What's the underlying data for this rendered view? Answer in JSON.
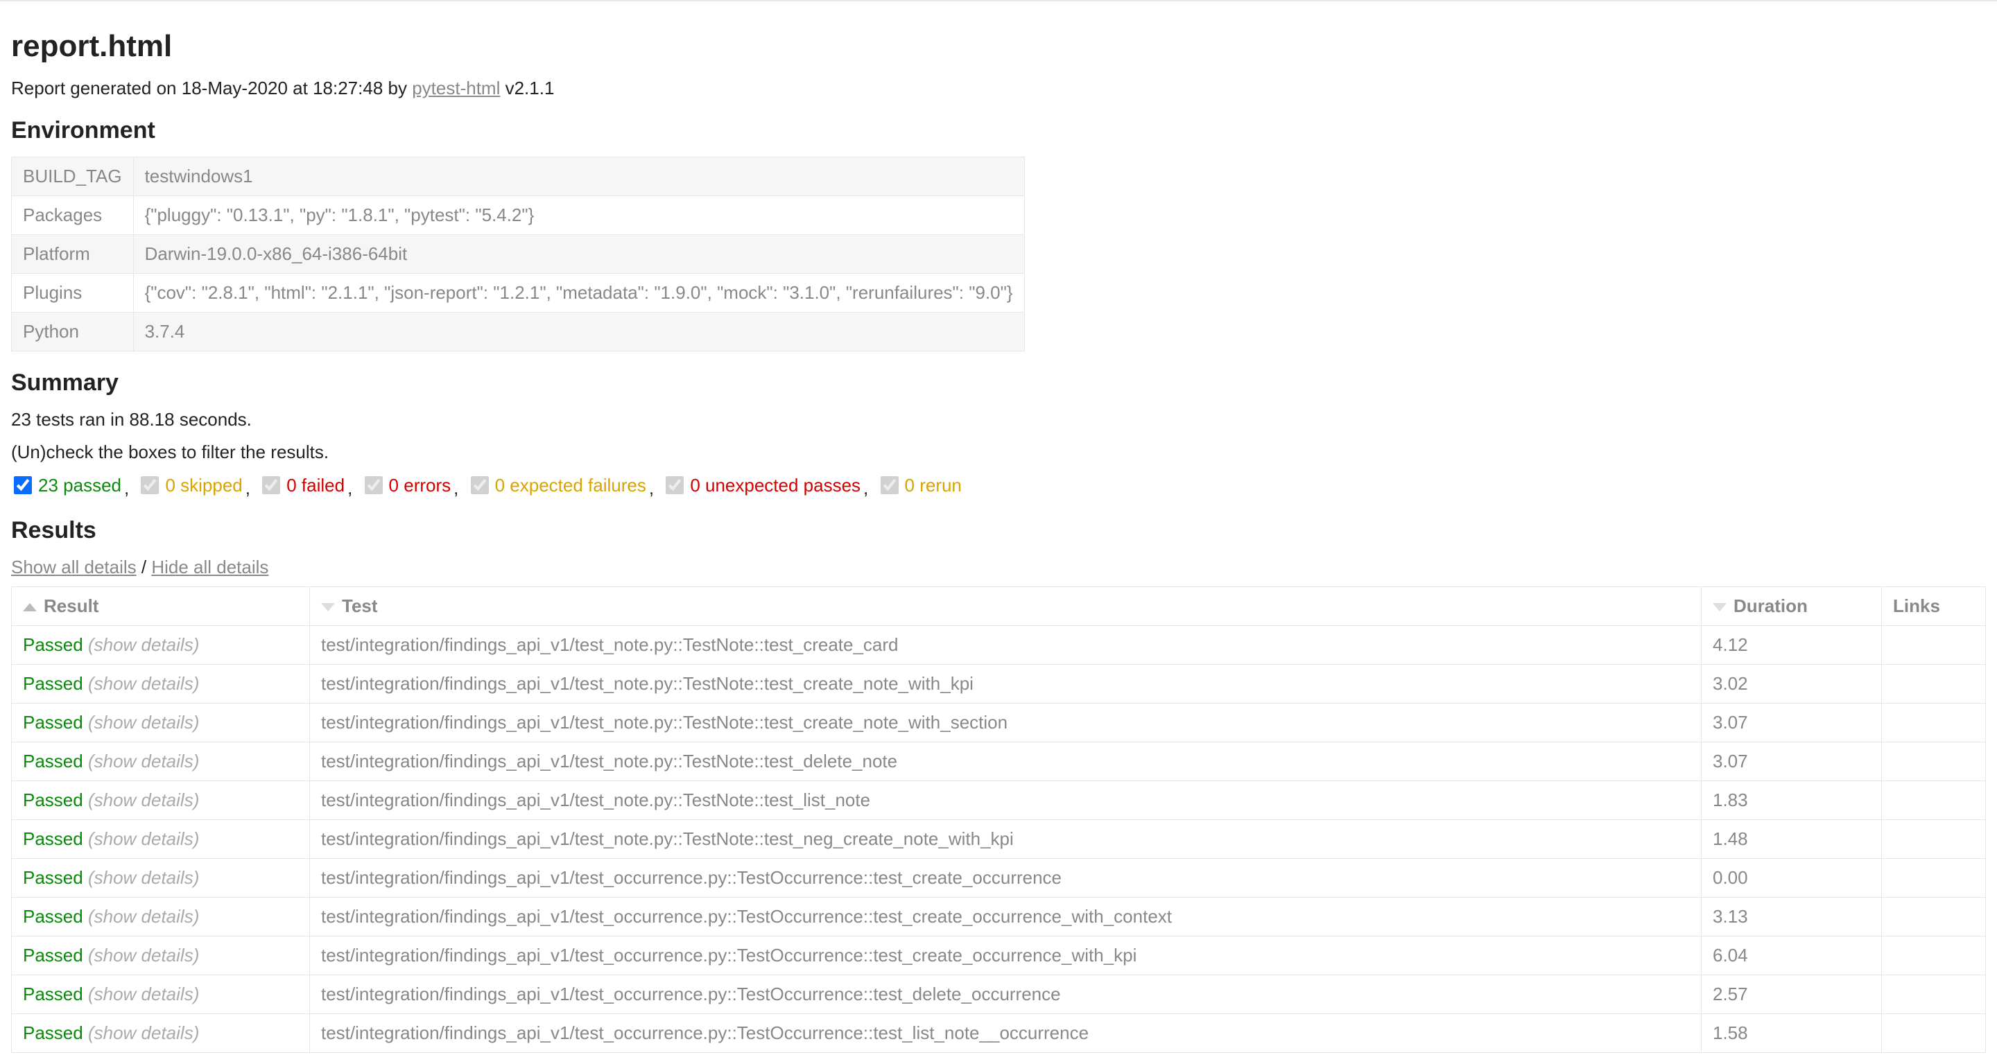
{
  "title": "report.html",
  "report_meta": {
    "prefix": "Report generated on ",
    "date": "18-May-2020",
    "at": " at ",
    "time": "18:27:48",
    "by": " by ",
    "tool_link": "pytest-html",
    "version": " v2.1.1"
  },
  "environment": {
    "heading": "Environment",
    "rows": [
      {
        "key": "BUILD_TAG",
        "value": "testwindows1"
      },
      {
        "key": "Packages",
        "value": "{\"pluggy\": \"0.13.1\", \"py\": \"1.8.1\", \"pytest\": \"5.4.2\"}"
      },
      {
        "key": "Platform",
        "value": "Darwin-19.0.0-x86_64-i386-64bit"
      },
      {
        "key": "Plugins",
        "value": "{\"cov\": \"2.8.1\", \"html\": \"2.1.1\", \"json-report\": \"1.2.1\", \"metadata\": \"1.9.0\", \"mock\": \"3.1.0\", \"rerunfailures\": \"9.0\"}"
      },
      {
        "key": "Python",
        "value": "3.7.4"
      }
    ]
  },
  "summary": {
    "heading": "Summary",
    "tests_ran_text": "23 tests ran in 88.18 seconds.",
    "filter_hint": "(Un)check the boxes to filter the results.",
    "filters": {
      "passed": {
        "label": "23 passed",
        "checked": true,
        "enabled": true
      },
      "skipped": {
        "label": "0 skipped",
        "checked": true,
        "enabled": false
      },
      "failed": {
        "label": "0 failed",
        "checked": true,
        "enabled": false
      },
      "errors": {
        "label": "0 errors",
        "checked": true,
        "enabled": false
      },
      "xfailed": {
        "label": "0 expected failures",
        "checked": true,
        "enabled": false
      },
      "xpassed": {
        "label": "0 unexpected passes",
        "checked": true,
        "enabled": false
      },
      "rerun": {
        "label": "0 rerun",
        "checked": true,
        "enabled": false
      }
    }
  },
  "results": {
    "heading": "Results",
    "show_all": "Show all details",
    "separator": " / ",
    "hide_all": "Hide all details",
    "columns": {
      "result": "Result",
      "test": "Test",
      "duration": "Duration",
      "links": "Links"
    },
    "show_details_label": "(show details)",
    "passed_label": "Passed",
    "rows": [
      {
        "name": "test/integration/findings_api_v1/test_note.py::TestNote::test_create_card",
        "duration": "4.12"
      },
      {
        "name": "test/integration/findings_api_v1/test_note.py::TestNote::test_create_note_with_kpi",
        "duration": "3.02"
      },
      {
        "name": "test/integration/findings_api_v1/test_note.py::TestNote::test_create_note_with_section",
        "duration": "3.07"
      },
      {
        "name": "test/integration/findings_api_v1/test_note.py::TestNote::test_delete_note",
        "duration": "3.07"
      },
      {
        "name": "test/integration/findings_api_v1/test_note.py::TestNote::test_list_note",
        "duration": "1.83"
      },
      {
        "name": "test/integration/findings_api_v1/test_note.py::TestNote::test_neg_create_note_with_kpi",
        "duration": "1.48"
      },
      {
        "name": "test/integration/findings_api_v1/test_occurrence.py::TestOccurrence::test_create_occurrence",
        "duration": "0.00"
      },
      {
        "name": "test/integration/findings_api_v1/test_occurrence.py::TestOccurrence::test_create_occurrence_with_context",
        "duration": "3.13"
      },
      {
        "name": "test/integration/findings_api_v1/test_occurrence.py::TestOccurrence::test_create_occurrence_with_kpi",
        "duration": "6.04"
      },
      {
        "name": "test/integration/findings_api_v1/test_occurrence.py::TestOccurrence::test_delete_occurrence",
        "duration": "2.57"
      },
      {
        "name": "test/integration/findings_api_v1/test_occurrence.py::TestOccurrence::test_list_note__occurrence",
        "duration": "1.58"
      }
    ]
  }
}
